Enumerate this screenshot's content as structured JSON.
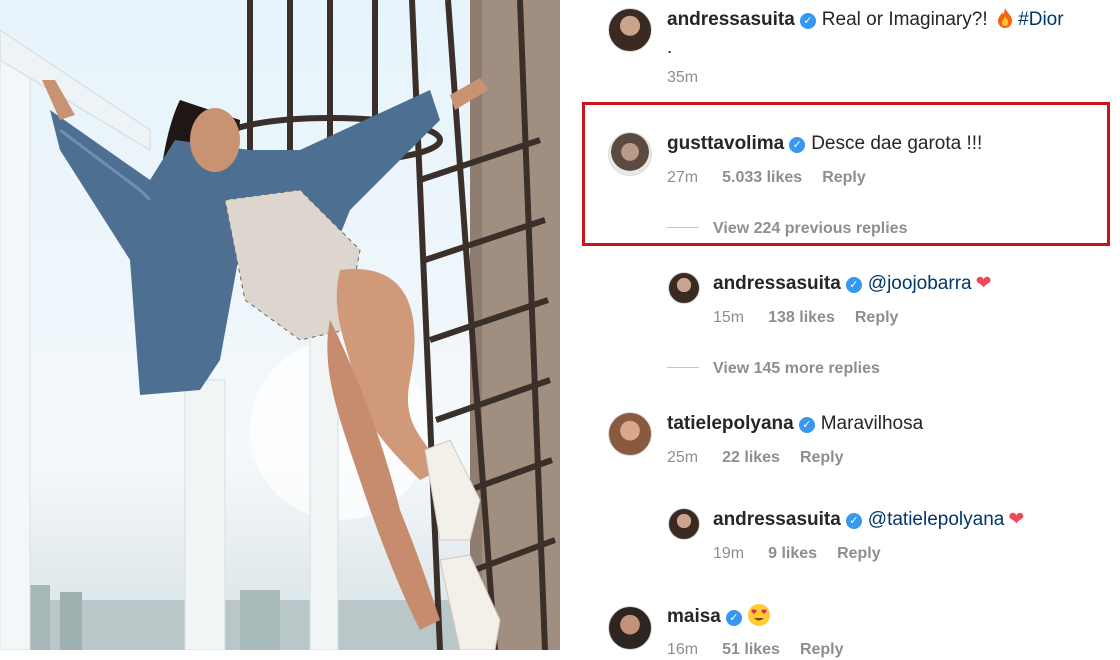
{
  "colors": {
    "highlight": "#c8141e",
    "verified": "#3897f0",
    "link": "#00376b",
    "muted": "#8e8e8e"
  },
  "comments": [
    {
      "username": "andressasuita",
      "text": "Real or Imaginary?! ",
      "emoji": "fire-icon",
      "hashtag": "#Dior",
      "extra_line": ".",
      "time": "35m"
    },
    {
      "username": "gusttavolima",
      "text": "Desce dae garota !!!",
      "time": "27m",
      "likes": "5.033 likes",
      "reply": "Reply",
      "view_replies": "View 224 previous replies"
    },
    {
      "username": "andressasuita",
      "mention": "@joojobarra",
      "emoji": "heart-icon",
      "time": "15m",
      "likes": "138 likes",
      "reply": "Reply",
      "view_replies": "View 145 more replies"
    },
    {
      "username": "tatielepolyana",
      "text": "Maravilhosa",
      "time": "25m",
      "likes": "22 likes",
      "reply": "Reply"
    },
    {
      "username": "andressasuita",
      "mention": "@tatielepolyana",
      "emoji": "heart-icon",
      "time": "19m",
      "likes": "9 likes",
      "reply": "Reply"
    },
    {
      "username": "maisa",
      "emoji": "heart-eyes-emoji",
      "time": "16m",
      "likes": "51 likes",
      "reply": "Reply"
    }
  ],
  "verified_mark": "✓",
  "heart_glyph": "❤"
}
